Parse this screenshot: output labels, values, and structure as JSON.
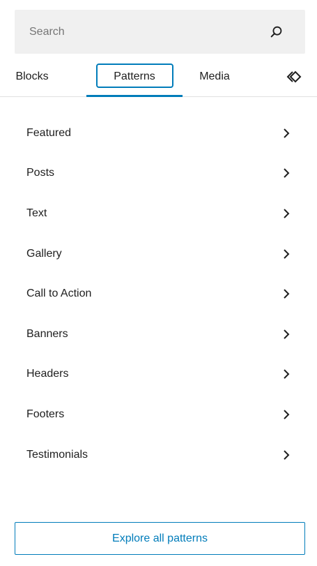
{
  "search": {
    "placeholder": "Search",
    "value": "",
    "icon": "search-icon"
  },
  "tabs": [
    {
      "label": "Blocks",
      "selected": false
    },
    {
      "label": "Patterns",
      "selected": true
    },
    {
      "label": "Media",
      "selected": false
    },
    {
      "label": "",
      "icon": "synced-patterns-diamond-icon",
      "selected": false
    }
  ],
  "categories": [
    {
      "label": "Featured"
    },
    {
      "label": "Posts"
    },
    {
      "label": "Text"
    },
    {
      "label": "Gallery"
    },
    {
      "label": "Call to Action"
    },
    {
      "label": "Banners"
    },
    {
      "label": "Headers"
    },
    {
      "label": "Footers"
    },
    {
      "label": "Testimonials"
    }
  ],
  "explore_button": {
    "label": "Explore all patterns"
  },
  "colors": {
    "accent": "#007cba",
    "search_bg": "#f0f0f0",
    "text": "#1e1e1e",
    "placeholder": "#757575",
    "divider": "#e0e0e0"
  }
}
